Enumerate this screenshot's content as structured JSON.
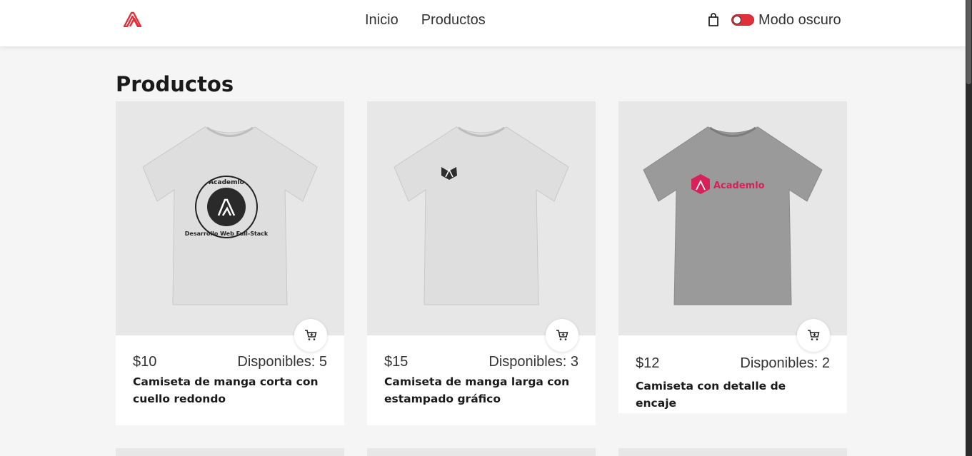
{
  "header": {
    "logo_name": "academlo-logo",
    "nav": [
      "Inicio",
      "Productos"
    ],
    "dark_mode_label": "Modo oscuro",
    "accent_color": "#e0313b"
  },
  "page_title": "Productos",
  "products": [
    {
      "price": "$10",
      "stock": "Disponibles: 5",
      "name": "Camiseta de manga corta con cuello redondo",
      "shirt_color": "#dcdcdc",
      "print_text": "Academlo",
      "print_subtext": "Desarrollo Web Full-Stack"
    },
    {
      "price": "$15",
      "stock": "Disponibles: 3",
      "name": "Camiseta de manga larga con estampado gráfico",
      "shirt_color": "#dcdcdc"
    },
    {
      "price": "$12",
      "stock": "Disponibles: 2",
      "name": "Camiseta con detalle de encaje",
      "shirt_color": "#9a9a9a",
      "print_text": "Academlo"
    }
  ]
}
